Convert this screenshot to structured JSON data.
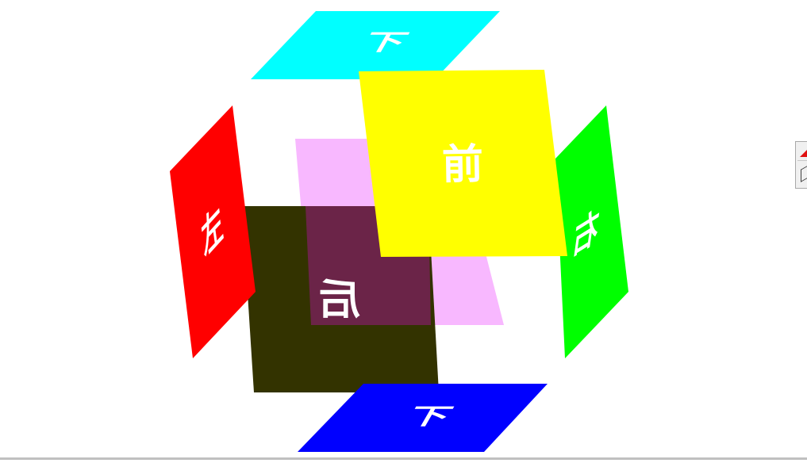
{
  "scene": {
    "faces": {
      "top": {
        "label": "下",
        "color": "#00ffff"
      },
      "front": {
        "label": "前",
        "color": "#ffff00"
      },
      "left": {
        "label": "左",
        "color": "#ff0000"
      },
      "right": {
        "label": "右",
        "color": "#00ff00"
      },
      "back": {
        "label": "后",
        "color": "#333300",
        "text_color": "#f8b8ff"
      },
      "pink": {
        "label": "",
        "color": "#f8b8ff"
      },
      "bottom": {
        "label": "下",
        "color": "#0000ff"
      }
    }
  },
  "toolbox": {
    "tool_a_icon": "red-triangle-icon",
    "tool_b_icon": "cube-outline-icon"
  }
}
